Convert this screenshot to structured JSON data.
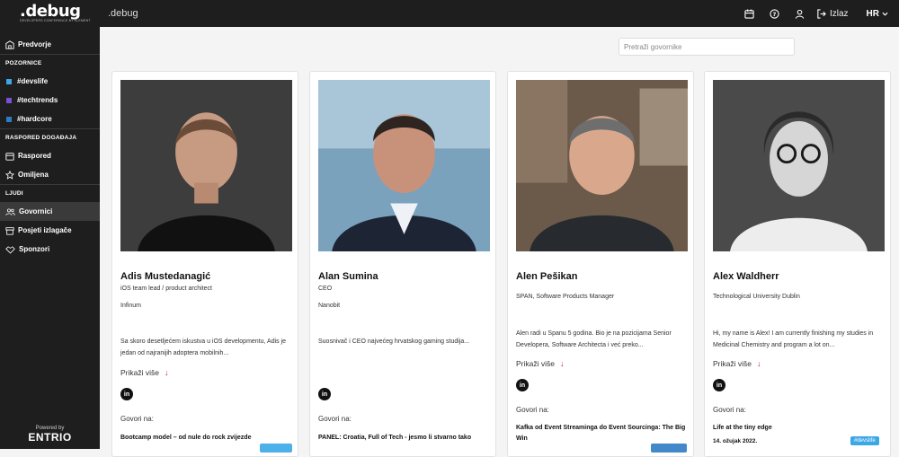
{
  "header": {
    "logo": ".debug",
    "logo_sub": "DEVELOPERS CONFERENCE BY ELEMENT",
    "app_title": ".debug",
    "logout_label": "Izlaz",
    "language": "HR"
  },
  "sidebar": {
    "items": [
      {
        "label": "Predvorje",
        "icon": "building-icon"
      },
      {
        "label": "POZORNICE",
        "type": "section"
      },
      {
        "label": "#devslife",
        "color": "#3ba7e6"
      },
      {
        "label": "#techtrends",
        "color": "#7b4fd6"
      },
      {
        "label": "#hardcore",
        "color": "#2f7cc4"
      },
      {
        "label": "RASPORED DOGAĐAJA",
        "type": "section"
      },
      {
        "label": "Raspored",
        "icon": "calendar-icon"
      },
      {
        "label": "Omiljena",
        "icon": "star-icon"
      },
      {
        "label": "LJUDI",
        "type": "section"
      },
      {
        "label": "Govornici",
        "icon": "people-icon",
        "active": true
      },
      {
        "label": "Posjeti izlagače",
        "icon": "booth-icon"
      },
      {
        "label": "Sponzori",
        "icon": "handshake-icon"
      }
    ],
    "powered_label": "Powered by",
    "powered_logo": "ENTRIO"
  },
  "search": {
    "placeholder": "Pretraži govornike"
  },
  "speakers": [
    {
      "name": "Adis Mustedanagić",
      "role": "iOS team lead / product architect",
      "org": "Infinum",
      "bio": "Sa skoro desetljećem iskustva u iOS developmentu, Adis je jedan od najranijih adoptera mobilnih...",
      "more": "Prikaži više",
      "talks_label": "Govori na:",
      "talk_title": "Bootcamp model – od nule do rock zvijezde",
      "talk_date": "",
      "stage": ""
    },
    {
      "name": "Alan Sumina",
      "role": "CEO",
      "org": "Nanobit",
      "bio": "Suosnivač i CEO najvećeg hrvatskog gaming studija...",
      "more": "Prikaži više",
      "talks_label": "Govori na:",
      "talk_title": "PANEL: Croatia, Full of Tech - jesmo li stvarno tako",
      "talk_date": "",
      "stage": ""
    },
    {
      "name": "Alen Pešikan",
      "role": "SPAN, Software Products Manager",
      "org": "",
      "bio": "Alen radi u Spanu 5 godina. Bio je na pozicijama Senior Developera, Software Architecta i već preko...",
      "more": "Prikaži više",
      "talks_label": "Govori na:",
      "talk_title": "Kafka od Event Streaminga do Event Sourcinga: The Big Win",
      "talk_date": "",
      "stage": ""
    },
    {
      "name": "Alex Waldherr",
      "role": "Technological University Dublin",
      "org": "",
      "bio": "Hi, my name is Alex! I am currently finishing my studies in Medicinal Chemistry and program a lot on...",
      "more": "Prikaži više",
      "talks_label": "Govori na:",
      "talk_title": "Life at the tiny edge",
      "talk_date": "14. ožujak 2022.",
      "stage": "#devslife"
    }
  ],
  "colors": {
    "accent": "#c2185b",
    "badge": "#3ba7e6",
    "dark": "#1e1e1e"
  }
}
